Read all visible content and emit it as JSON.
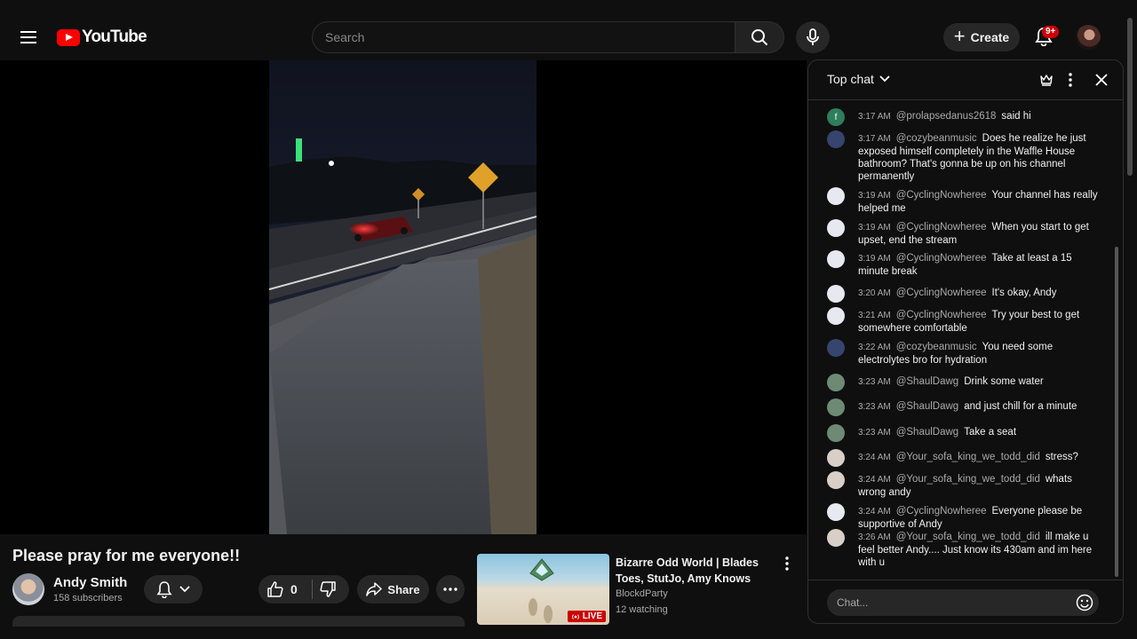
{
  "masthead": {
    "logo_text": "YouTube",
    "search_placeholder": "Search",
    "create_label": "Create",
    "notifications_badge": "9+"
  },
  "video": {
    "title": "Please pray for me everyone!!",
    "channel": {
      "name": "Andy Smith",
      "subscribers": "158 subscribers"
    },
    "likes": "0",
    "share_label": "Share"
  },
  "recommended": {
    "title": "Bizarre Odd World | Blades Toes, StutJo, Amy Knows",
    "channel": "BlockdParty",
    "watching": "12 watching",
    "badge": "LIVE"
  },
  "chat": {
    "mode_label": "Top chat",
    "input_placeholder": "Chat...",
    "messages": [
      {
        "time": "3:17 AM",
        "author": "@prolapsedanus2618",
        "text": "said hi",
        "avatar_color": "#2e7d5b",
        "avatar_letter": "f"
      },
      {
        "time": "3:17 AM",
        "author": "@cozybeanmusic",
        "text": "Does he realize he just exposed himself completely in the Waffle House bathroom? That's gonna be up on his channel permanently",
        "avatar_color": "#35456e",
        "avatar_letter": ""
      },
      {
        "time": "3:19 AM",
        "author": "@CyclingNowheree",
        "text": "Your channel has really helped me",
        "avatar_color": "#e8e8f0",
        "avatar_letter": ""
      },
      {
        "time": "3:19 AM",
        "author": "@CyclingNowheree",
        "text": "When you start to get upset, end the stream",
        "avatar_color": "#e8e8f0",
        "avatar_letter": ""
      },
      {
        "time": "3:19 AM",
        "author": "@CyclingNowheree",
        "text": "Take at least a 15 minute break",
        "avatar_color": "#e8e8f0",
        "avatar_letter": ""
      },
      {
        "time": "3:20 AM",
        "author": "@CyclingNowheree",
        "text": "It's okay, Andy",
        "avatar_color": "#e8e8f0",
        "avatar_letter": ""
      },
      {
        "time": "3:21 AM",
        "author": "@CyclingNowheree",
        "text": "Try your best to get somewhere comfortable",
        "avatar_color": "#e8e8f0",
        "avatar_letter": ""
      },
      {
        "time": "3:22 AM",
        "author": "@cozybeanmusic",
        "text": "You need some electrolytes bro for hydration",
        "avatar_color": "#35456e",
        "avatar_letter": ""
      },
      {
        "time": "3:23 AM",
        "author": "@ShaulDawg",
        "text": "Drink some water",
        "avatar_color": "#6f8a74",
        "avatar_letter": ""
      },
      {
        "time": "3:23 AM",
        "author": "@ShaulDawg",
        "text": "and just chill for a minute",
        "avatar_color": "#6f8a74",
        "avatar_letter": ""
      },
      {
        "time": "3:23 AM",
        "author": "@ShaulDawg",
        "text": "Take a seat",
        "avatar_color": "#6f8a74",
        "avatar_letter": ""
      },
      {
        "time": "3:24 AM",
        "author": "@Your_sofa_king_we_todd_did",
        "text": "stress?",
        "avatar_color": "#d8cfc8",
        "avatar_letter": ""
      },
      {
        "time": "3:24 AM",
        "author": "@Your_sofa_king_we_todd_did",
        "text": "whats wrong andy",
        "avatar_color": "#d8cfc8",
        "avatar_letter": ""
      },
      {
        "time": "3:24 AM",
        "author": "@CyclingNowheree",
        "text": "Everyone please be supportive of Andy",
        "avatar_color": "#e8e8f0",
        "avatar_letter": ""
      },
      {
        "time": "3:26 AM",
        "author": "@Your_sofa_king_we_todd_did",
        "text": "ill make u feel better Andy.... Just know its 430am and im here with u",
        "avatar_color": "#d8cfc8",
        "avatar_letter": ""
      }
    ]
  }
}
